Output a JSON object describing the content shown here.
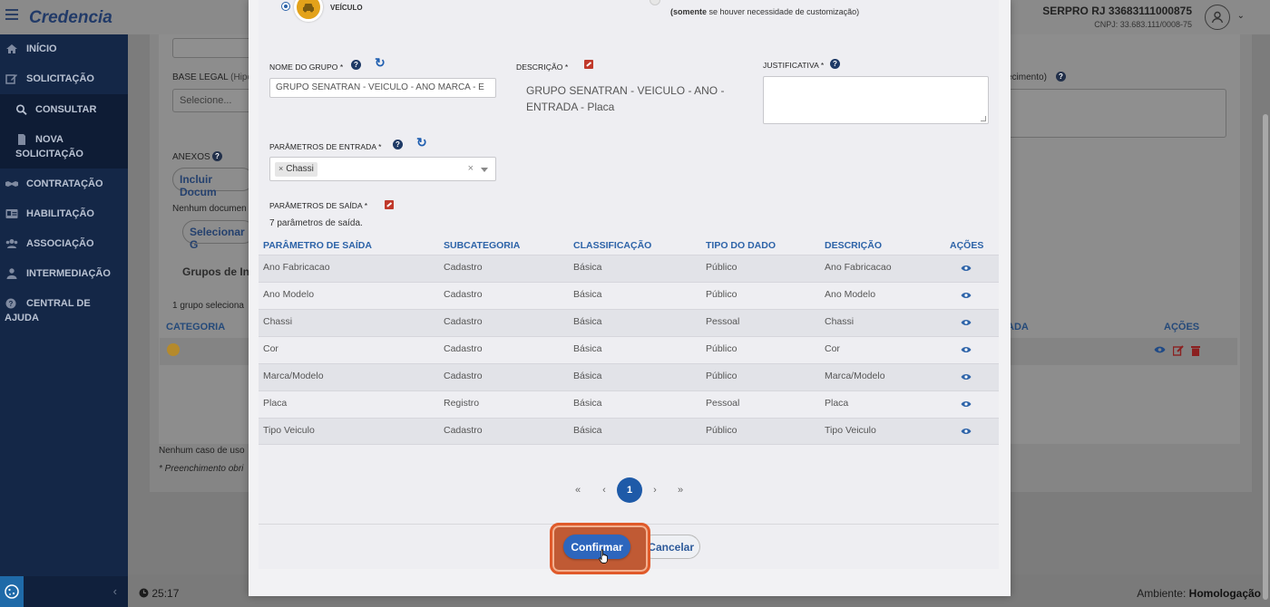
{
  "app": {
    "brand": "Credencia",
    "user_name": "SERPRO RJ 33683111000875",
    "user_cnpj": "CNPJ: 33.683.111/0008-75"
  },
  "sidebar": {
    "items": [
      {
        "label": "INÍCIO",
        "icon": "home-icon"
      },
      {
        "label": "SOLICITAÇÃO",
        "icon": "edit-icon"
      },
      {
        "label": "CONSULTAR",
        "icon": "search-icon"
      },
      {
        "label": "NOVA",
        "label2": "SOLICITAÇÃO",
        "icon": "file-icon"
      },
      {
        "label": "CONTRATAÇÃO",
        "icon": "handshake-icon"
      },
      {
        "label": "HABILITAÇÃO",
        "icon": "id-card-icon"
      },
      {
        "label": "ASSOCIAÇÃO",
        "icon": "users-icon"
      },
      {
        "label": "INTERMEDIAÇÃO",
        "icon": "user-tie-icon"
      },
      {
        "label": "CENTRAL DE",
        "label2": "AJUDA",
        "icon": "help-circle-icon"
      }
    ]
  },
  "background": {
    "base_legal_label": "BASE LEGAL",
    "base_legal_hint": "(Hipó",
    "select_placeholder": "Selecione...",
    "anexos_label": "ANEXOS",
    "incluir_doc": "Incluir Docum",
    "nenhum_doc": "Nenhum documen",
    "selecionar": "Selecionar G",
    "grupos": "Grupos de In",
    "grupo_sel": "1 grupo seleciona",
    "categoria": "CATEGORIA",
    "ada": "ADA",
    "acoes": "AÇÕES",
    "nenhum_caso": "Nenhum caso de uso",
    "preenchimento": "* Preenchimento obri",
    "right_hint": "ecimento)"
  },
  "footer": {
    "timer": "25:17",
    "env_label": "Ambiente:",
    "env_value": "Homologação"
  },
  "modal": {
    "vehicle_label": "VEÍCULO",
    "custom_note_bold": "(somente",
    "custom_note_rest": " se houver necessidade de customização)",
    "nome_grupo_label": "NOME DO GRUPO *",
    "nome_grupo_value": "GRUPO SENATRAN - VEICULO - ANO MARCA - E",
    "descricao_label": "DESCRIÇÃO *",
    "descricao_value": "GRUPO SENATRAN - VEICULO - ANO - ENTRADA - Placa",
    "justificativa_label": "JUSTIFICATIVA *",
    "parametros_entrada_label": "PARÂMETROS DE ENTRADA *",
    "parametro_entrada_tag": "Chassi",
    "tag_remove": "×",
    "clear_symbol": "×",
    "parametros_saida_label": "PARÂMETROS DE SAÍDA *",
    "parametros_saida_count": "7 parâmetros de saída.",
    "table": {
      "headers": [
        "PARÂMETRO DE SAÍDA",
        "SUBCATEGORIA",
        "CLASSIFICAÇÃO",
        "TIPO DO DADO",
        "DESCRIÇÃO",
        "AÇÕES"
      ],
      "rows": [
        [
          "Ano Fabricacao",
          "Cadastro",
          "Básica",
          "Público",
          "Ano Fabricacao"
        ],
        [
          "Ano Modelo",
          "Cadastro",
          "Básica",
          "Público",
          "Ano Modelo"
        ],
        [
          "Chassi",
          "Cadastro",
          "Básica",
          "Pessoal",
          "Chassi"
        ],
        [
          "Cor",
          "Cadastro",
          "Básica",
          "Público",
          "Cor"
        ],
        [
          "Marca/Modelo",
          "Cadastro",
          "Básica",
          "Público",
          "Marca/Modelo"
        ],
        [
          "Placa",
          "Registro",
          "Básica",
          "Pessoal",
          "Placa"
        ],
        [
          "Tipo Veiculo",
          "Cadastro",
          "Básica",
          "Público",
          "Tipo Veiculo"
        ]
      ]
    },
    "pagination": {
      "first": "«",
      "prev": "‹",
      "current": "1",
      "next": "›",
      "last": "»"
    },
    "confirm_label": "Confirmar",
    "cancel_label": "Cancelar"
  },
  "colors": {
    "accent": "#2d66bd",
    "header_blue": "#2d63a8",
    "sidebar": "#142747",
    "highlight": "#e05a2a",
    "vehicle_icon": "#e3a21a"
  }
}
